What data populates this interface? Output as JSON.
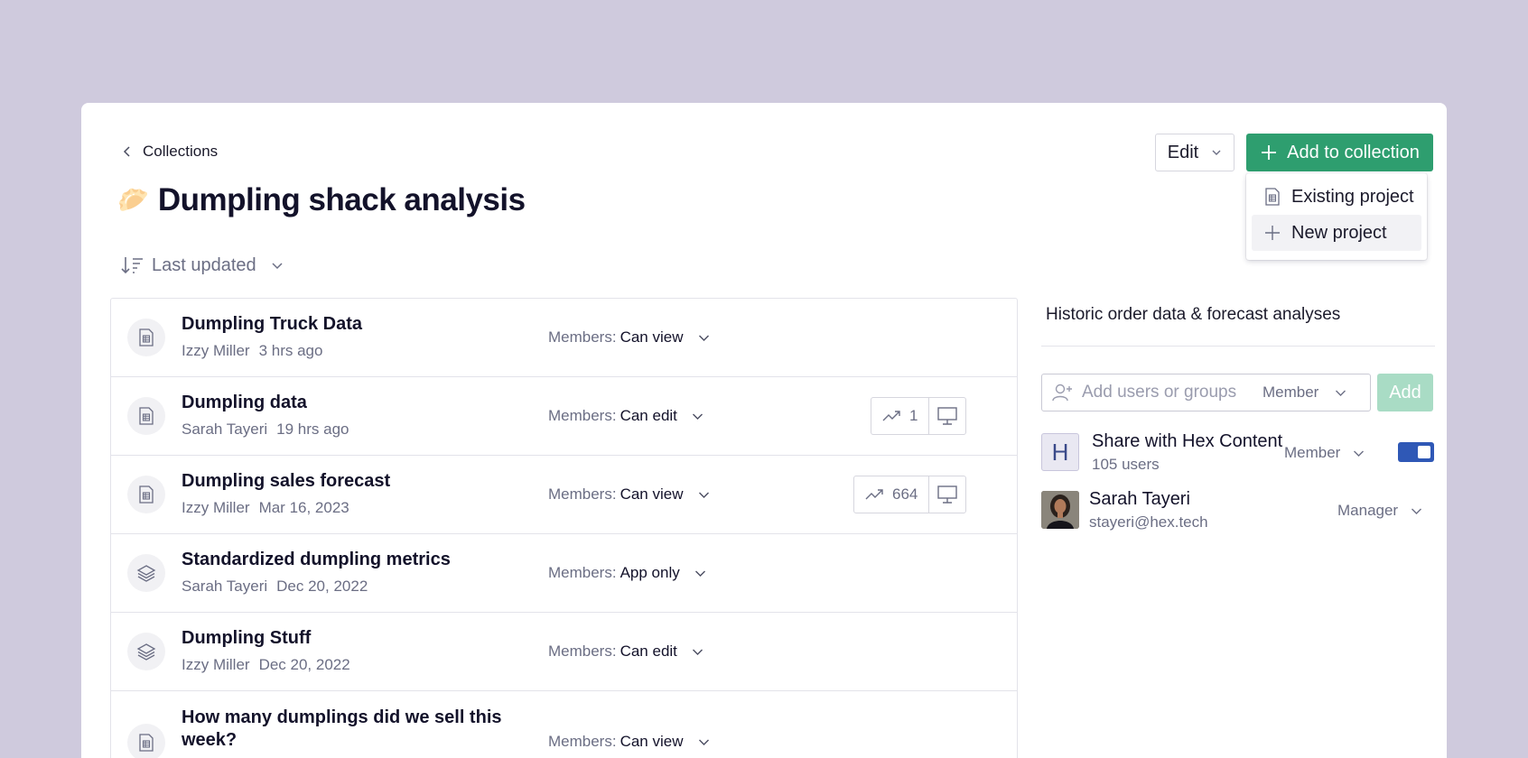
{
  "header": {
    "back_label": "Collections",
    "emoji": "🥟",
    "title": "Dumpling shack analysis",
    "edit_label": "Edit",
    "add_label": "Add to collection"
  },
  "add_menu": {
    "items": [
      {
        "label": "Existing project"
      },
      {
        "label": "New project"
      }
    ]
  },
  "sort": {
    "label": "Last updated"
  },
  "projects": [
    {
      "name": "Dumpling Truck Data",
      "owner": "Izzy Miller",
      "updated": "3 hrs ago",
      "members_label": "Members:",
      "permission": "Can view",
      "icon": "notebook-icon"
    },
    {
      "name": "Dumpling data",
      "owner": "Sarah Tayeri",
      "updated": "19 hrs ago",
      "members_label": "Members:",
      "permission": "Can edit",
      "icon": "notebook-icon",
      "views": "1"
    },
    {
      "name": "Dumpling sales forecast",
      "owner": "Izzy Miller",
      "updated": "Mar 16, 2023",
      "members_label": "Members:",
      "permission": "Can view",
      "icon": "notebook-icon",
      "views": "664"
    },
    {
      "name": "Standardized dumpling metrics",
      "owner": "Sarah Tayeri",
      "updated": "Dec 20, 2022",
      "members_label": "Members:",
      "permission": "App only",
      "icon": "layers-icon"
    },
    {
      "name": "Dumpling Stuff",
      "owner": "Izzy Miller",
      "updated": "Dec 20, 2022",
      "members_label": "Members:",
      "permission": "Can edit",
      "icon": "layers-icon"
    },
    {
      "name": "How many dumplings did we sell this week?",
      "owner": "",
      "updated": "",
      "members_label": "Members:",
      "permission": "Can view",
      "icon": "notebook-icon"
    }
  ],
  "sharing": {
    "description": "Historic order data & forecast analyses",
    "invite_placeholder": "Add users or groups",
    "invite_role": "Member",
    "add_button": "Add",
    "group": {
      "initial": "H",
      "name": "Share with Hex Content",
      "sub": "105 users",
      "role": "Member",
      "enabled": true
    },
    "user": {
      "name": "Sarah Tayeri",
      "email": "stayeri@hex.tech",
      "role": "Manager"
    }
  },
  "colors": {
    "background": "#cfcadd",
    "primary_green": "#2e9e6f",
    "toggle_blue": "#2f58b6"
  }
}
